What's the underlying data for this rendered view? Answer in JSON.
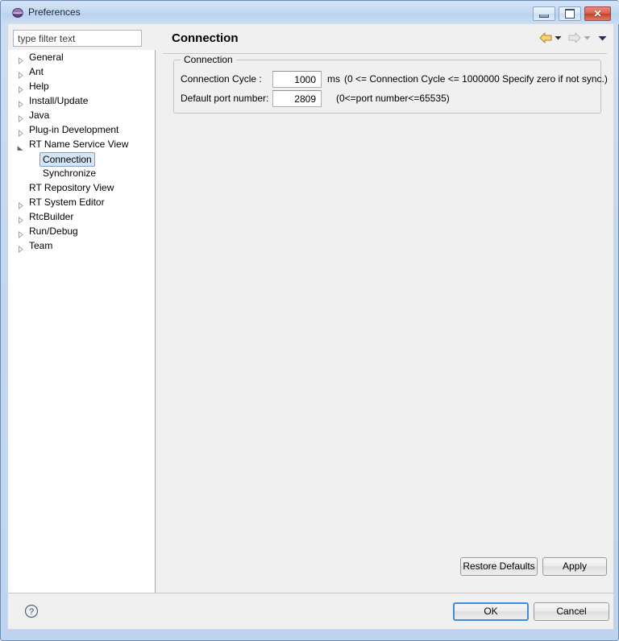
{
  "window": {
    "title": "Preferences",
    "icon": "eclipse-sphere-icon",
    "controls": {
      "minimize": "minimize-button",
      "maximize": "maximize-button",
      "close": "close-button"
    }
  },
  "sidebar": {
    "filter": {
      "value": "type filter text",
      "placeholder": "type filter text"
    },
    "items": [
      {
        "label": "General",
        "indent": 0,
        "state": "collapsed",
        "selected": false
      },
      {
        "label": "Ant",
        "indent": 0,
        "state": "collapsed",
        "selected": false
      },
      {
        "label": "Help",
        "indent": 0,
        "state": "collapsed",
        "selected": false
      },
      {
        "label": "Install/Update",
        "indent": 0,
        "state": "collapsed",
        "selected": false
      },
      {
        "label": "Java",
        "indent": 0,
        "state": "collapsed",
        "selected": false
      },
      {
        "label": "Plug-in Development",
        "indent": 0,
        "state": "collapsed",
        "selected": false
      },
      {
        "label": "RT Name Service View",
        "indent": 0,
        "state": "expanded",
        "selected": false
      },
      {
        "label": "Connection",
        "indent": 1,
        "state": "leaf",
        "selected": true
      },
      {
        "label": "Synchronize",
        "indent": 1,
        "state": "leaf",
        "selected": false
      },
      {
        "label": "RT Repository View",
        "indent": 0,
        "state": "leaf",
        "selected": false
      },
      {
        "label": "RT System Editor",
        "indent": 0,
        "state": "collapsed",
        "selected": false
      },
      {
        "label": "RtcBuilder",
        "indent": 0,
        "state": "collapsed",
        "selected": false
      },
      {
        "label": "Run/Debug",
        "indent": 0,
        "state": "collapsed",
        "selected": false
      },
      {
        "label": "Team",
        "indent": 0,
        "state": "collapsed",
        "selected": false
      }
    ]
  },
  "main": {
    "title": "Connection",
    "nav": {
      "back_icon": "back-arrow-icon",
      "back_menu_icon": "chevron-down-icon",
      "forward_icon": "forward-arrow-icon",
      "forward_menu_icon": "chevron-down-icon",
      "view_menu_icon": "chevron-down-icon"
    },
    "group": {
      "legend": "Connection",
      "fields": [
        {
          "label": "Connection Cycle :",
          "value": "1000",
          "unit": "ms",
          "hint": "(0 <= Connection Cycle <= 1000000 Specify zero if not sync.)"
        },
        {
          "label": "Default port number:",
          "value": "2809",
          "unit": "",
          "hint": "(0<=port number<=65535)"
        }
      ]
    },
    "buttons": {
      "restore_defaults": "Restore Defaults",
      "apply": "Apply"
    }
  },
  "footer": {
    "help_icon": "help-question-icon",
    "ok": "OK",
    "cancel": "Cancel"
  },
  "colors": {
    "window_frame": "#bed4ee",
    "titlebar": "#c5d9f1",
    "close_button": "#c33f2c",
    "panel_bg": "#f0f0f0",
    "tree_bg": "#ffffff",
    "selection_bg": "#d6e6f7",
    "selection_border": "#7da2ce",
    "focus_border": "#3c8ddb",
    "back_arrow": "#f2c14b",
    "forward_arrow": "#d4d4d4"
  }
}
